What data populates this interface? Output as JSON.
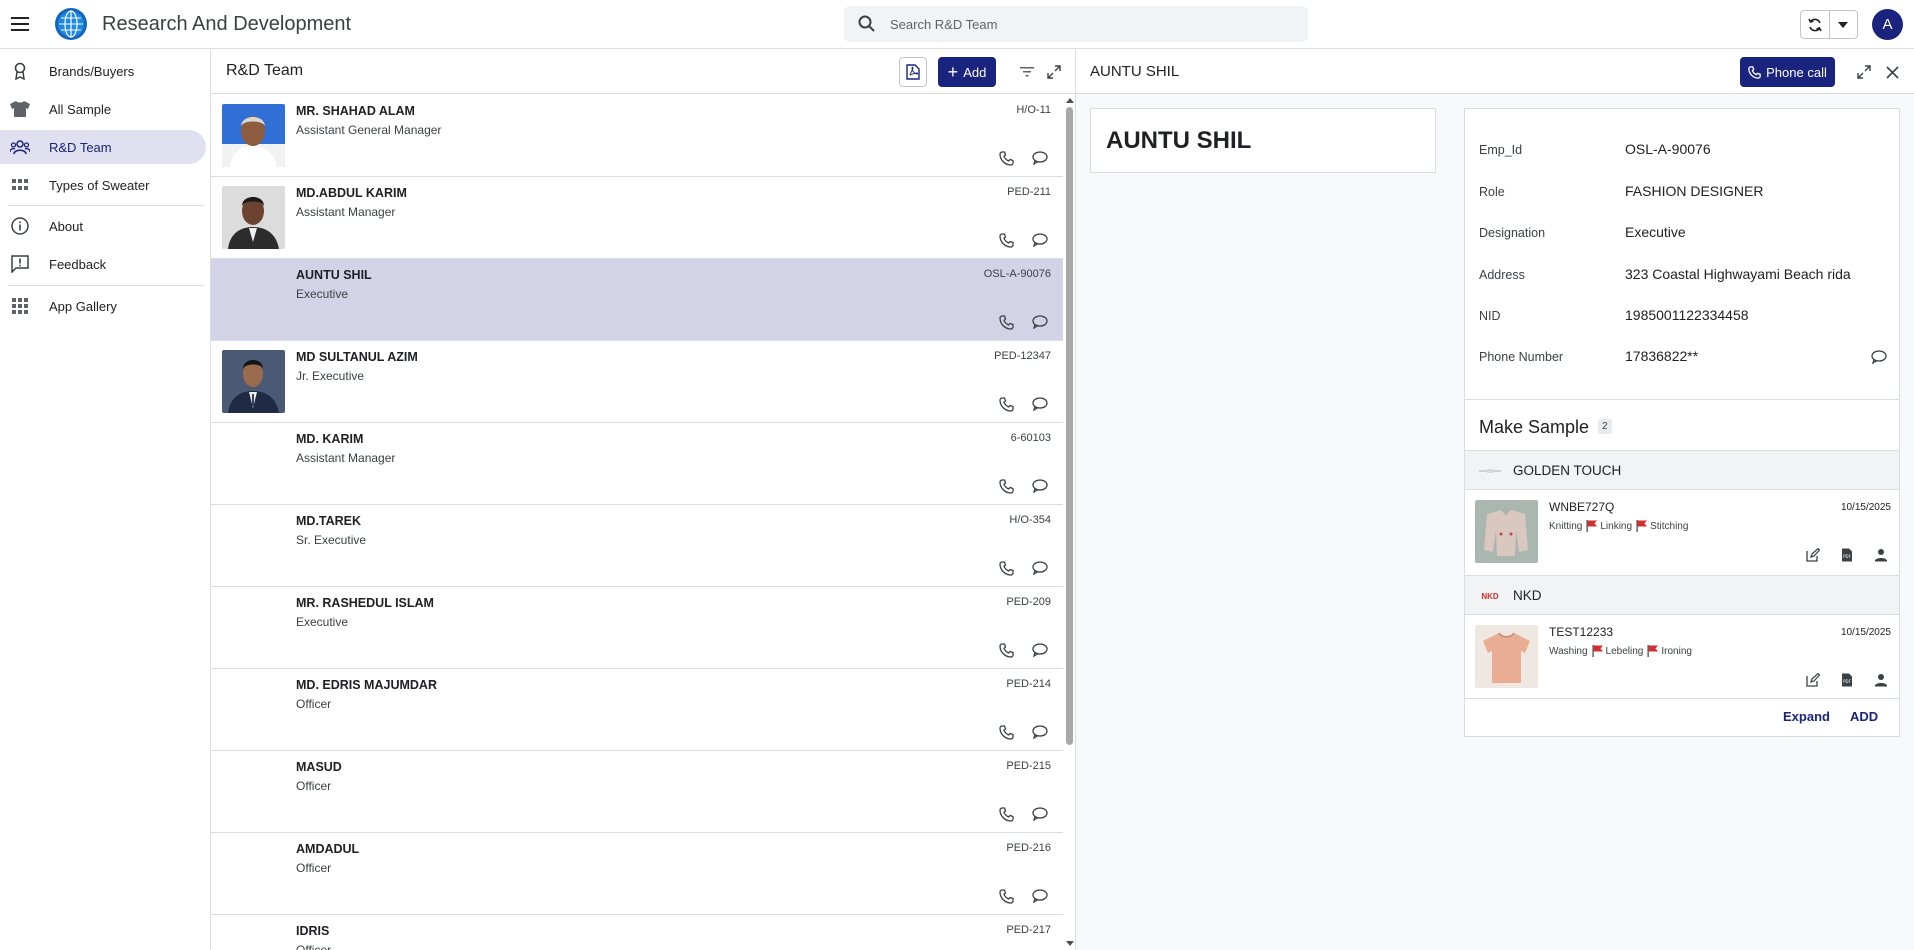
{
  "app": {
    "title": "Research And Development",
    "avatar_letter": "A"
  },
  "search": {
    "placeholder": "Search R&D Team"
  },
  "sidebar": {
    "items": [
      {
        "label": "Brands/Buyers",
        "icon": "award-icon"
      },
      {
        "label": "All Sample",
        "icon": "shirt-icon"
      },
      {
        "label": "R&D Team",
        "icon": "people-icon",
        "active": true
      },
      {
        "label": "Types of Sweater",
        "icon": "grid-icon"
      },
      {
        "label": "About",
        "icon": "info-icon"
      },
      {
        "label": "Feedback",
        "icon": "feedback-icon"
      },
      {
        "label": "App Gallery",
        "icon": "apps-icon"
      }
    ]
  },
  "list": {
    "title": "R&D Team",
    "add_label": "Add",
    "rows": [
      {
        "name": "MR. SHAHAD ALAM",
        "role": "Assistant General Manager",
        "code": "H/O-11",
        "has_photo": true
      },
      {
        "name": "MD.ABDUL KARIM",
        "role": "Assistant Manager",
        "code": "PED-211",
        "has_photo": true
      },
      {
        "name": "AUNTU SHIL",
        "role": "Executive",
        "code": "OSL-A-90076",
        "has_photo": false,
        "selected": true
      },
      {
        "name": "MD SULTANUL AZIM",
        "role": "Jr. Executive",
        "code": "PED-12347",
        "has_photo": true
      },
      {
        "name": "MD. KARIM",
        "role": "Assistant Manager",
        "code": "6-60103",
        "has_photo": false
      },
      {
        "name": "MD.TAREK",
        "role": "Sr. Executive",
        "code": "H/O-354",
        "has_photo": false
      },
      {
        "name": "MR. RASHEDUL ISLAM",
        "role": "Executive",
        "code": "PED-209",
        "has_photo": false
      },
      {
        "name": "MD. EDRIS MAJUMDAR",
        "role": "Officer",
        "code": "PED-214",
        "has_photo": false
      },
      {
        "name": "MASUD",
        "role": "Officer",
        "code": "PED-215",
        "has_photo": false
      },
      {
        "name": "AMDADUL",
        "role": "Officer",
        "code": "PED-216",
        "has_photo": false
      },
      {
        "name": "IDRIS",
        "role": "Officer",
        "code": "PED-217",
        "has_photo": false
      }
    ]
  },
  "detail": {
    "header_title": "AUNTU SHIL",
    "call_label": "Phone call",
    "big_name": "AUNTU SHIL",
    "fields": [
      {
        "key": "Emp_Id",
        "value": "OSL-A-90076"
      },
      {
        "key": "Role",
        "value": "FASHION DESIGNER"
      },
      {
        "key": "Designation",
        "value": "Executive"
      },
      {
        "key": "Address",
        "value": "323 Coastal Highwayami Beach rida"
      },
      {
        "key": "NID",
        "value": "1985001122334458"
      },
      {
        "key": "Phone Number",
        "value": "17836822**"
      }
    ],
    "make_sample": {
      "title": "Make Sample",
      "count": "2",
      "brands": [
        {
          "name": "GOLDEN TOUCH",
          "item": {
            "code": "WNBE727Q",
            "date": "10/15/2025",
            "stages": [
              "Knitting",
              "Linking",
              "Stitching"
            ]
          }
        },
        {
          "name": "NKD",
          "logo_text": "NKD",
          "item": {
            "code": "TEST12233",
            "date": "10/15/2025",
            "stages": [
              "Washing",
              "Lebeling",
              "Ironing"
            ]
          }
        }
      ],
      "expand_label": "Expand",
      "add_label": "ADD"
    }
  },
  "colors": {
    "primary": "#1a237e",
    "selected_row": "#d3d3e8",
    "flag": "#d32f2f"
  }
}
